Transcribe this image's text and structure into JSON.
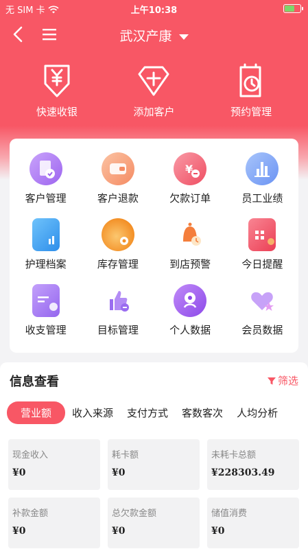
{
  "status_bar": {
    "carrier": "无 SIM 卡",
    "time": "上午10:38"
  },
  "nav": {
    "title": "武汉产康"
  },
  "quick_actions": [
    {
      "label": "快速收银",
      "icon": "yen-receipt-icon"
    },
    {
      "label": "添加客户",
      "icon": "add-customer-diamond-icon"
    },
    {
      "label": "预约管理",
      "icon": "appointment-clock-icon"
    }
  ],
  "grid_items": [
    {
      "label": "客户管理",
      "icon": "customer-management-icon",
      "color": "#b07bf4"
    },
    {
      "label": "客户退款",
      "icon": "customer-refund-icon",
      "color": "#f7a178"
    },
    {
      "label": "欠款订单",
      "icon": "debt-order-icon",
      "color": "#f46b7b"
    },
    {
      "label": "员工业绩",
      "icon": "staff-performance-icon",
      "color": "#7aa4f7"
    },
    {
      "label": "护理档案",
      "icon": "care-record-icon",
      "color": "#3fa3f0"
    },
    {
      "label": "库存管理",
      "icon": "inventory-icon",
      "color": "#f6a047"
    },
    {
      "label": "到店预警",
      "icon": "arrival-alert-bell-icon",
      "color": "#f47e3c"
    },
    {
      "label": "今日提醒",
      "icon": "today-reminder-calendar-icon",
      "color": "#f25566"
    },
    {
      "label": "收支管理",
      "icon": "income-expense-icon",
      "color": "#a77bf1"
    },
    {
      "label": "目标管理",
      "icon": "goal-thumbs-up-icon",
      "color": "#9a6df0"
    },
    {
      "label": "个人数据",
      "icon": "personal-data-icon",
      "color": "#a064f2"
    },
    {
      "label": "会员数据",
      "icon": "member-data-heart-icon",
      "color": "#b98af7"
    }
  ],
  "info": {
    "title": "信息查看",
    "filter_label": "筛选",
    "tabs": [
      "营业额",
      "收入来源",
      "支付方式",
      "客数客次",
      "人均分析"
    ],
    "stats": [
      {
        "label": "现金收入",
        "value": "¥0"
      },
      {
        "label": "耗卡额",
        "value": "¥0"
      },
      {
        "label": "未耗卡总额",
        "value": "¥228303.49"
      },
      {
        "label": "补款金额",
        "value": "¥0"
      },
      {
        "label": "总欠款金额",
        "value": "¥0"
      },
      {
        "label": "储值消费",
        "value": "¥0"
      }
    ]
  }
}
